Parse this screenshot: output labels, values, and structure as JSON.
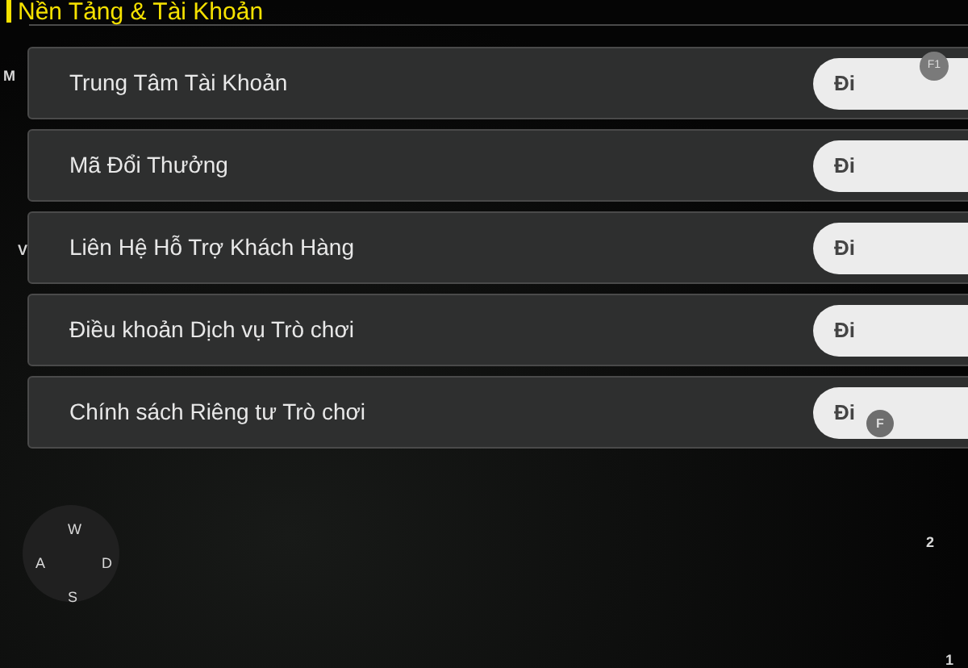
{
  "header": {
    "title": "Nền Tảng & Tài Khoản"
  },
  "rows": [
    {
      "label": "Trung Tâm Tài Khoản",
      "button": "Đi"
    },
    {
      "label": "Mã Đổi Thưởng",
      "button": "Đi"
    },
    {
      "label": "Liên Hệ Hỗ Trợ Khách Hàng",
      "button": "Đi"
    },
    {
      "label": "Điều khoản Dịch vụ Trò chơi",
      "button": "Đi"
    },
    {
      "label": "Chính sách Riêng tư Trò chơi",
      "button": "Đi"
    }
  ],
  "key_hints": {
    "menu": "M",
    "row": "V",
    "f1": "F1",
    "f": "F",
    "up": "W",
    "left": "A",
    "right": "D",
    "down": "S",
    "two": "2",
    "one": "1"
  }
}
